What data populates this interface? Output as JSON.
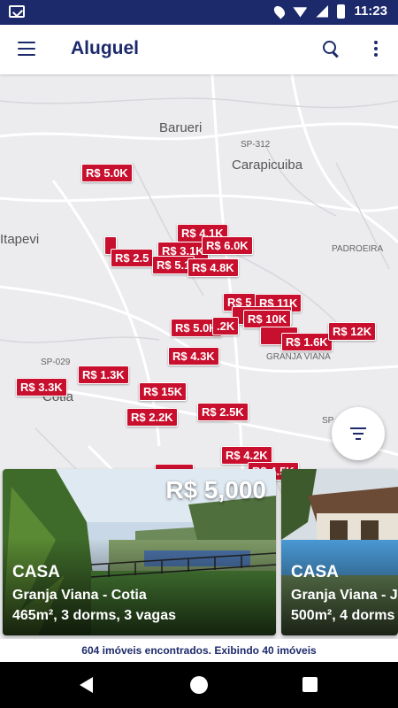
{
  "status_bar": {
    "time": "11:23"
  },
  "app_bar": {
    "title": "Aluguel"
  },
  "map": {
    "places": [
      {
        "name": "Barueri",
        "cls": ""
      },
      {
        "name": "Carapicuiba",
        "cls": ""
      },
      {
        "name": "Itapevi",
        "cls": ""
      },
      {
        "name": "Cotia",
        "cls": ""
      },
      {
        "name": "SP-312",
        "cls": "small"
      },
      {
        "name": "SP-029",
        "cls": "small"
      },
      {
        "name": "PADROEIRA",
        "cls": "small"
      },
      {
        "name": "GRANJA VIANA",
        "cls": "small"
      },
      {
        "name": "SP",
        "cls": "small"
      }
    ],
    "prices": [
      "R$ 5.0K",
      "R$ 4.1K",
      "R$ 3.1K",
      "R$ 6.0K",
      "R$ 2.5",
      "R$ 5.1",
      "R$ 4.8K",
      "R$ 5",
      "R$ 11K",
      "R$ 10K",
      "R$ 5.0K",
      ".2K",
      "R$ 1.6K",
      "R$ 12K",
      "R$ 4.3K",
      "R$ 1.3K",
      "R$ 3.3K",
      "R$ 15K",
      "R$ 2.2K",
      "R$ 2.5K",
      "R$ 4.2K",
      "R$ 4.5K"
    ]
  },
  "cards": [
    {
      "price": "R$ 5,000",
      "type": "CASA",
      "location": "Granja Viana - Cotia",
      "features": "465m²,  3 dorms,  3 vagas"
    },
    {
      "price": "",
      "type": "CASA",
      "location": "Granja Viana - J",
      "features": "500m²,  4 dorms"
    }
  ],
  "footer": {
    "text": "604 imóveis encontrados. Exibindo 40 imóveis"
  },
  "colors": {
    "primary": "#1c2a6b",
    "accent": "#c8102e"
  }
}
